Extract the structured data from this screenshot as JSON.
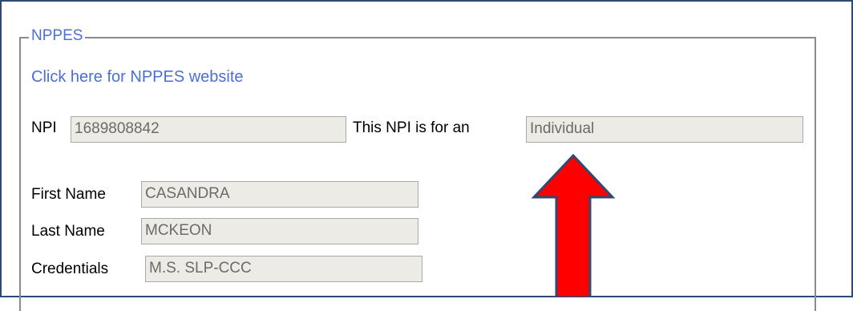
{
  "nppes": {
    "legend": "NPPES",
    "website_link": "Click here for NPPES website",
    "npi": {
      "label": "NPI",
      "value": "1689808842"
    },
    "npi_type": {
      "label": "This NPI is for an",
      "value": "Individual"
    },
    "first_name": {
      "label": "First Name",
      "value": "CASANDRA"
    },
    "last_name": {
      "label": "Last Name",
      "value": "MCKEON"
    },
    "credentials": {
      "label": "Credentials",
      "value": "M.S. SLP-CCC"
    }
  },
  "annotation": {
    "arrow_color": "#ff0000",
    "arrow_outline_color": "#2e4a73",
    "icon": "up-arrow-icon"
  }
}
